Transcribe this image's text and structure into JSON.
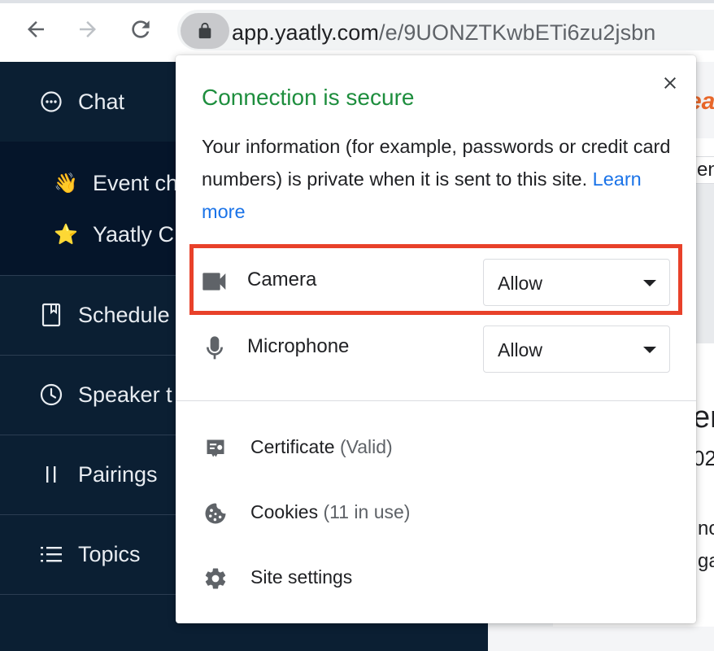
{
  "browser": {
    "url_host": "app.yaatly.com",
    "url_path": "/e/9UONZTKwbETi6zu2jsbn"
  },
  "sidebar": {
    "chat_label": "Chat",
    "sub_items": [
      {
        "emoji": "👋",
        "label": "Event ch"
      },
      {
        "emoji": "⭐",
        "label": "Yaatly C"
      }
    ],
    "nav_items": [
      {
        "label": "Schedule",
        "icon": "book-icon"
      },
      {
        "label": "Speaker t",
        "icon": "clock-icon"
      },
      {
        "label": "Pairings",
        "icon": "pause-bars-icon"
      },
      {
        "label": "Topics",
        "icon": "list-icon"
      }
    ]
  },
  "content_peek": {
    "brand_fragment": "ea",
    "tab_fragment": "en",
    "heading_fragment": "er",
    "year_fragment": "02",
    "line1_fragment": "no",
    "line2_fragment": "ga"
  },
  "popup": {
    "title": "Connection is secure",
    "description": "Your information (for example, passwords or credit card numbers) is private when it is sent to this site.",
    "learn_more": "Learn more",
    "permissions": [
      {
        "label": "Camera",
        "value": "Allow",
        "icon": "camera-icon"
      },
      {
        "label": "Microphone",
        "value": "Allow",
        "icon": "microphone-icon"
      }
    ],
    "links": [
      {
        "label": "Certificate",
        "meta": "(Valid)",
        "icon": "certificate-icon"
      },
      {
        "label": "Cookies",
        "meta": "(11 in use)",
        "icon": "cookie-icon"
      },
      {
        "label": "Site settings",
        "meta": "",
        "icon": "gear-icon"
      }
    ]
  },
  "colors": {
    "secure_green": "#1e8e3e",
    "link_blue": "#1a73e8",
    "highlight_red": "#e8412a",
    "sidebar_navy": "#0b1f33",
    "brand_orange": "#e8672a"
  }
}
